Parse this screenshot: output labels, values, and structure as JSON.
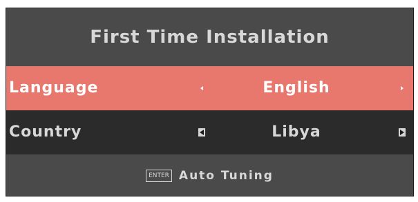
{
  "dialog": {
    "title": "First Time Installation"
  },
  "settings": [
    {
      "label": "Language",
      "value": "English",
      "selected": true
    },
    {
      "label": "Country",
      "value": "Libya",
      "selected": false
    }
  ],
  "footer": {
    "key_label": "ENTER",
    "action_label": "Auto Tuning"
  },
  "icons": {
    "left": "arrow-left-icon",
    "right": "arrow-right-icon"
  },
  "colors": {
    "panel_bg": "#4a4a4a",
    "selected_row": "#e8786e",
    "unselected_row": "#2b2b2b",
    "text": "#d8d8d8"
  }
}
